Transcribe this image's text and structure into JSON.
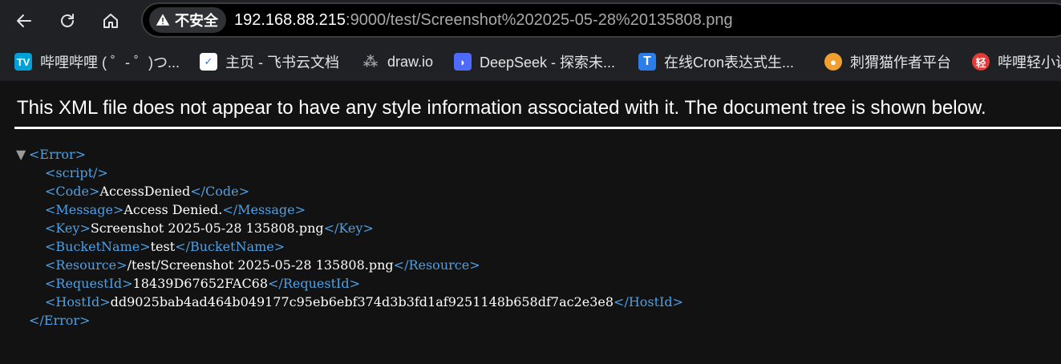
{
  "toolbar": {
    "back_icon": "arrow-left-icon",
    "reload_icon": "reload-icon",
    "home_icon": "home-icon"
  },
  "omnibox": {
    "security_label": "不安全",
    "url_host": "192.168.88.215",
    "url_path": ":9000/test/Screenshot%202025-05-28%20135808.png"
  },
  "bookmarks": [
    {
      "label": "哔哩哔哩 ( ゜- ゜)つ...",
      "icon": "bilibili-icon",
      "color": "#00a1d6"
    },
    {
      "label": "主页 - 飞书云文档",
      "icon": "feishu-docs-icon",
      "color": "#3370ff"
    },
    {
      "label": "draw.io",
      "icon": "drawio-icon",
      "color": "#9aa0a6"
    },
    {
      "label": "DeepSeek - 探索未...",
      "icon": "deepseek-icon",
      "color": "#4d6bfe"
    },
    {
      "label": "在线Cron表达式生...",
      "icon": "cron-icon",
      "color": "#2b7de9"
    },
    {
      "label": "刺猬猫作者平台",
      "icon": "ciweimao-icon",
      "color": "#f0a030"
    },
    {
      "label": "哔哩轻小说",
      "icon": "bili-novel-icon",
      "color": "#e53935"
    }
  ],
  "notice": "This XML file does not appear to have any style information associated with it. The document tree is shown below.",
  "xml": {
    "root_open": "<Error>",
    "root_close": "</Error>",
    "toggle": "▼",
    "script_tag": "<script/>",
    "elements": [
      {
        "open": "<Code>",
        "value": "AccessDenied",
        "close": "</Code>"
      },
      {
        "open": "<Message>",
        "value": "Access Denied.",
        "close": "</Message>"
      },
      {
        "open": "<Key>",
        "value": "Screenshot 2025-05-28 135808.png",
        "close": "</Key>"
      },
      {
        "open": "<BucketName>",
        "value": "test",
        "close": "</BucketName>"
      },
      {
        "open": "<Resource>",
        "value": "/test/Screenshot 2025-05-28 135808.png",
        "close": "</Resource>"
      },
      {
        "open": "<RequestId>",
        "value": "18439D67652FAC68",
        "close": "</RequestId>"
      },
      {
        "open": "<HostId>",
        "value": "dd9025bab4ad464b049177c95eb6ebf374d3b3fd1af9251148b658df7ac2e3e8",
        "close": "</HostId>"
      }
    ]
  },
  "colors": {
    "tag": "#4ea0e6",
    "background": "#121212",
    "chrome": "#202124"
  }
}
